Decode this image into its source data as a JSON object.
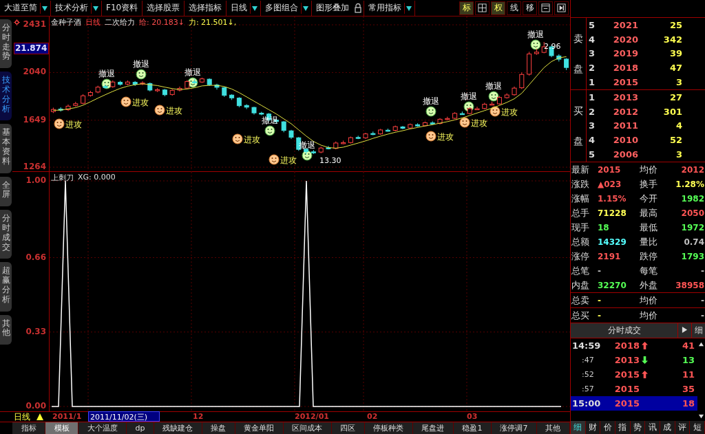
{
  "toolbar": [
    {
      "label": "大道至简",
      "dropdown": true
    },
    {
      "label": "技术分析",
      "dropdown": true
    },
    {
      "label": "F10资料",
      "dropdown": false
    },
    {
      "label": "选择股票",
      "dropdown": false
    },
    {
      "label": "选择指标",
      "dropdown": false
    },
    {
      "label": "日线",
      "dropdown": true
    },
    {
      "label": "多图组合",
      "dropdown": true
    },
    {
      "label": "图形叠加",
      "dropdown": false,
      "lock": true
    },
    {
      "label": "常用指标",
      "dropdown": true
    }
  ],
  "view_buttons": [
    {
      "kind": "text",
      "label": "标",
      "selected": true
    },
    {
      "kind": "grid",
      "selected": false
    },
    {
      "kind": "text",
      "label": "权",
      "selected": true
    },
    {
      "kind": "text",
      "label": "线",
      "selected": false
    },
    {
      "kind": "text",
      "label": "移",
      "selected": false
    },
    {
      "kind": "window",
      "selected": false
    },
    {
      "kind": "next",
      "selected": false
    }
  ],
  "side_tabs": [
    {
      "label": "分时走势",
      "selected": false
    },
    {
      "label": "技术分析",
      "selected": true
    },
    {
      "label": "基本资料",
      "selected": false
    },
    {
      "label": "全屏",
      "selected": false
    },
    {
      "label": "分时成交",
      "selected": false
    },
    {
      "label": "超赢分析",
      "selected": false
    },
    {
      "label": "其他",
      "selected": false
    }
  ],
  "price_chart": {
    "stock": "金种子酒",
    "period": "日线",
    "indicator": "二次给力",
    "cursor_label": "21.874",
    "chart_data": {
      "type": "candlestick",
      "grid": true,
      "ylim": [
        1225,
        2499
      ],
      "ohlc": [
        [
          1720,
          1752,
          1708,
          1737
        ],
        [
          1740,
          1755,
          1720,
          1732
        ],
        [
          1735,
          1778,
          1725,
          1764
        ],
        [
          1770,
          1800,
          1760,
          1784
        ],
        [
          1788,
          1862,
          1780,
          1849
        ],
        [
          1852,
          1890,
          1842,
          1876
        ],
        [
          1880,
          1932,
          1870,
          1920
        ],
        [
          1925,
          1942,
          1910,
          1921
        ],
        [
          1924,
          1975,
          1915,
          1962
        ],
        [
          1960,
          1972,
          1932,
          1943
        ],
        [
          1945,
          1975,
          1935,
          1962
        ],
        [
          1960,
          1970,
          1930,
          1944
        ],
        [
          1946,
          1968,
          1936,
          1954
        ],
        [
          1950,
          1958,
          1885,
          1896
        ],
        [
          1894,
          1912,
          1880,
          1899
        ],
        [
          1897,
          1905,
          1845,
          1858
        ],
        [
          1860,
          1905,
          1850,
          1894
        ],
        [
          1896,
          1925,
          1885,
          1910
        ],
        [
          1912,
          1978,
          1905,
          1966
        ],
        [
          1964,
          1988,
          1950,
          1960
        ],
        [
          1962,
          1998,
          1955,
          1988
        ],
        [
          1985,
          1992,
          1930,
          1940
        ],
        [
          1938,
          1948,
          1900,
          1919
        ],
        [
          1916,
          1922,
          1840,
          1853
        ],
        [
          1855,
          1862,
          1815,
          1832
        ],
        [
          1830,
          1838,
          1755,
          1768
        ],
        [
          1770,
          1780,
          1740,
          1756
        ],
        [
          1754,
          1760,
          1695,
          1709
        ],
        [
          1707,
          1718,
          1690,
          1702
        ],
        [
          1700,
          1708,
          1640,
          1652
        ],
        [
          1650,
          1662,
          1620,
          1638
        ],
        [
          1636,
          1642,
          1550,
          1565
        ],
        [
          1562,
          1570,
          1495,
          1509
        ],
        [
          1505,
          1512,
          1398,
          1410
        ],
        [
          1412,
          1420,
          1370,
          1392
        ],
        [
          1390,
          1405,
          1372,
          1386
        ],
        [
          1388,
          1432,
          1378,
          1421
        ],
        [
          1423,
          1438,
          1410,
          1420
        ],
        [
          1418,
          1475,
          1410,
          1462
        ],
        [
          1464,
          1482,
          1452,
          1465
        ],
        [
          1466,
          1515,
          1458,
          1506
        ],
        [
          1508,
          1522,
          1494,
          1502
        ],
        [
          1504,
          1546,
          1496,
          1537
        ],
        [
          1540,
          1556,
          1526,
          1535
        ],
        [
          1537,
          1578,
          1530,
          1569
        ],
        [
          1567,
          1580,
          1555,
          1564
        ],
        [
          1566,
          1605,
          1558,
          1596
        ],
        [
          1594,
          1602,
          1575,
          1583
        ],
        [
          1585,
          1622,
          1578,
          1614
        ],
        [
          1612,
          1624,
          1594,
          1602
        ],
        [
          1604,
          1638,
          1598,
          1629
        ],
        [
          1627,
          1640,
          1612,
          1620
        ],
        [
          1622,
          1666,
          1615,
          1657
        ],
        [
          1655,
          1678,
          1648,
          1663
        ],
        [
          1665,
          1715,
          1658,
          1705
        ],
        [
          1703,
          1720,
          1694,
          1702
        ],
        [
          1704,
          1755,
          1698,
          1744
        ],
        [
          1742,
          1760,
          1735,
          1743
        ],
        [
          1745,
          1792,
          1738,
          1780
        ],
        [
          1778,
          1802,
          1770,
          1781
        ],
        [
          1783,
          1848,
          1776,
          1836
        ],
        [
          1834,
          1870,
          1826,
          1856
        ],
        [
          1858,
          1925,
          1850,
          1912
        ],
        [
          1915,
          2040,
          1905,
          2024
        ],
        [
          2026,
          2210,
          2015,
          2192
        ],
        [
          2195,
          2235,
          2185,
          2207
        ],
        [
          2205,
          2290,
          2198,
          2251
        ],
        [
          2250,
          2262,
          2165,
          2178
        ],
        [
          2176,
          2190,
          2130,
          2149
        ],
        [
          2150,
          2158,
          2060,
          2081
        ]
      ],
      "yticks": [
        {
          "value": 2431,
          "label": "2431"
        },
        {
          "value": 2040,
          "label": "2040"
        },
        {
          "value": 1649,
          "label": "1649"
        },
        {
          "value": 1264,
          "label": "1264"
        }
      ],
      "series": [
        {
          "type": "line",
          "color": "#e0e040",
          "values": [
            1730,
            1732,
            1742,
            1752,
            1772,
            1800,
            1830,
            1858,
            1885,
            1910,
            1928,
            1940,
            1948,
            1940,
            1933,
            1920,
            1908,
            1900,
            1905,
            1915,
            1930,
            1935,
            1935,
            1925,
            1905,
            1875,
            1840,
            1805,
            1770,
            1735,
            1700,
            1660,
            1620,
            1570,
            1520,
            1475,
            1445,
            1425,
            1420,
            1428,
            1445,
            1462,
            1480,
            1500,
            1518,
            1535,
            1550,
            1563,
            1578,
            1590,
            1602,
            1612,
            1625,
            1637,
            1652,
            1668,
            1688,
            1708,
            1728,
            1748,
            1770,
            1795,
            1825,
            1870,
            1940,
            2010,
            2080,
            2130,
            2160,
            2170
          ]
        }
      ]
    },
    "readouts": [
      {
        "text": "给: 20.183↓",
        "color": "#ff5050"
      },
      {
        "text": "力: 21.501↓,",
        "color": "#ffff50"
      }
    ],
    "signals": [
      {
        "kind": "attack",
        "label": "进攻"
      },
      {
        "kind": "retreat",
        "label": "撤退"
      },
      {
        "kind": "attack",
        "label": "进攻"
      },
      {
        "kind": "retreat",
        "label": "撤退"
      },
      {
        "kind": "attack",
        "label": "进攻"
      },
      {
        "kind": "retreat",
        "label": "撤退"
      },
      {
        "kind": "attack",
        "label": "进攻"
      },
      {
        "kind": "retreat",
        "label": "撤退"
      },
      {
        "kind": "attack",
        "label": "进攻"
      },
      {
        "kind": "retreat",
        "label": "撤退"
      },
      {
        "kind": "retreat",
        "label": "撤退"
      },
      {
        "kind": "attack",
        "label": "进攻"
      },
      {
        "kind": "retreat",
        "label": "撤退"
      },
      {
        "kind": "attack",
        "label": "进攻"
      },
      {
        "kind": "retreat",
        "label": "撤退"
      },
      {
        "kind": "attack",
        "label": "进攻"
      },
      {
        "kind": "retreat",
        "label": "撤退"
      }
    ],
    "low_mark": "13.30",
    "high_mark": "2.96"
  },
  "indicator_chart": {
    "name": "上刺刀",
    "readout": "XG: 0.000",
    "chart_data": {
      "type": "line",
      "ylim": [
        0,
        1
      ],
      "yticks": [
        {
          "value": 1,
          "label": "1.00"
        },
        {
          "value": 0.66,
          "label": "0.66"
        },
        {
          "value": 0.33,
          "label": "0.33"
        },
        {
          "value": 0,
          "label": "0.00"
        }
      ],
      "series": [
        {
          "color": "#ffffff",
          "values": [
            0,
            0,
            1,
            0,
            0,
            0,
            0,
            0,
            0,
            0,
            0,
            0,
            0,
            0,
            0,
            0,
            0,
            0,
            0,
            0,
            0,
            0,
            0,
            0,
            0,
            0,
            0,
            0,
            0,
            0,
            0,
            0,
            0,
            0,
            0,
            0,
            0,
            1,
            0,
            0,
            0,
            0,
            0,
            0,
            0,
            0,
            0,
            0,
            0,
            0,
            0,
            0,
            0,
            0,
            0,
            0,
            0,
            0,
            0,
            0,
            0,
            0,
            0,
            0,
            0,
            0,
            0,
            0,
            0,
            0,
            0,
            0,
            0,
            0,
            0
          ]
        }
      ]
    }
  },
  "date_bar": {
    "period": "日线",
    "dates": [
      "2011/1",
      "12",
      "2012/01",
      "02",
      "03"
    ],
    "cursor_date": "2011/11/02(三)"
  },
  "bottom_tabs": [
    {
      "label": "指标",
      "selected": false
    },
    {
      "label": "模板",
      "selected": true
    },
    {
      "label": "大个温度",
      "selected": false
    },
    {
      "label": "dp",
      "selected": false
    },
    {
      "label": "残缺建仓",
      "selected": false
    },
    {
      "label": "操盘",
      "selected": false
    },
    {
      "label": "黄金单阳",
      "selected": false
    },
    {
      "label": "区间成本",
      "selected": false
    },
    {
      "label": "四区",
      "selected": false
    },
    {
      "label": "停板种类",
      "selected": false
    },
    {
      "label": "尾盘进",
      "selected": false
    },
    {
      "label": "稳盈1",
      "selected": false
    },
    {
      "label": "涨停调7",
      "selected": false
    },
    {
      "label": "其他",
      "selected": false
    }
  ],
  "order_book": {
    "sell_label": "卖盘",
    "sell": [
      {
        "level": "5",
        "price": "2021",
        "volume": "25"
      },
      {
        "level": "4",
        "price": "2020",
        "volume": "342"
      },
      {
        "level": "3",
        "price": "2019",
        "volume": "39"
      },
      {
        "level": "2",
        "price": "2018",
        "volume": "47"
      },
      {
        "level": "1",
        "price": "2015",
        "volume": "3"
      }
    ],
    "buy_label": "买盘",
    "buy": [
      {
        "level": "1",
        "price": "2013",
        "volume": "27"
      },
      {
        "level": "2",
        "price": "2012",
        "volume": "301"
      },
      {
        "level": "3",
        "price": "2011",
        "volume": "4"
      },
      {
        "level": "4",
        "price": "2010",
        "volume": "52"
      },
      {
        "level": "5",
        "price": "2006",
        "volume": "3"
      }
    ]
  },
  "quote": [
    {
      "label": "最新",
      "value": "2015",
      "color": "#ff5555"
    },
    {
      "label": "均价",
      "value": "2012",
      "color": "#ff5555"
    },
    {
      "label": "涨跌",
      "value": "▲023",
      "color": "#ff5555"
    },
    {
      "label": "换手",
      "value": "1.28%",
      "color": "#ffff55"
    },
    {
      "label": "涨幅",
      "value": "1.15%",
      "color": "#ff5555"
    },
    {
      "label": "今开",
      "value": "1982",
      "color": "#55ff55"
    },
    {
      "label": "总手",
      "value": "71228",
      "color": "#ffff55"
    },
    {
      "label": "最高",
      "value": "2050",
      "color": "#ff5555"
    },
    {
      "label": "现手",
      "value": "18",
      "color": "#55ff55"
    },
    {
      "label": "最低",
      "value": "1972",
      "color": "#55ff55"
    },
    {
      "label": "总额",
      "value": "14329",
      "color": "#55ffff"
    },
    {
      "label": "量比",
      "value": "0.74",
      "color": "#c0c0c0"
    },
    {
      "label": "涨停",
      "value": "2191",
      "color": "#ff5555"
    },
    {
      "label": "跌停",
      "value": "1793",
      "color": "#55ff55"
    },
    {
      "label": "总笔",
      "value": "-",
      "color": "#c0c0c0"
    },
    {
      "label": "每笔",
      "value": "-",
      "color": "#c0c0c0"
    },
    {
      "label": "内盘",
      "value": "32270",
      "color": "#55ff55"
    },
    {
      "label": "外盘",
      "value": "38958",
      "color": "#ff5555"
    }
  ],
  "totals": [
    [
      {
        "label": "总卖",
        "value": "-",
        "color": "#ffff55"
      },
      {
        "label": "均价",
        "value": "-",
        "color": "#c0c0c0"
      }
    ],
    [
      {
        "label": "总买",
        "value": "-",
        "color": "#ffff55"
      },
      {
        "label": "均价",
        "value": "-",
        "color": "#c0c0c0"
      }
    ]
  ],
  "ticks_panel": {
    "title": "分时成交",
    "detail_button": "细",
    "ticks": [
      {
        "kind": "minute",
        "time": "14:59",
        "price": "2018",
        "rising": true,
        "falling": false,
        "volume": "41",
        "selected": false
      },
      {
        "kind": "second",
        "time": ":47",
        "price": "2013",
        "rising": false,
        "falling": true,
        "volume": "13",
        "selected": false
      },
      {
        "kind": "second",
        "time": ":52",
        "price": "2015",
        "rising": true,
        "falling": false,
        "volume": "11",
        "selected": false
      },
      {
        "kind": "second",
        "time": ":57",
        "price": "2015",
        "rising": false,
        "falling": false,
        "volume": "35",
        "selected": false
      },
      {
        "kind": "minute",
        "time": "15:00",
        "price": "2015",
        "rising": false,
        "falling": false,
        "volume": "18",
        "selected": true
      }
    ]
  },
  "panel_tabs": [
    {
      "label": "细",
      "selected": true
    },
    {
      "label": "财",
      "selected": false
    },
    {
      "label": "价",
      "selected": false
    },
    {
      "label": "指",
      "selected": false
    },
    {
      "label": "势",
      "selected": false
    },
    {
      "label": "讯",
      "selected": false
    },
    {
      "label": "成",
      "selected": false
    },
    {
      "label": "评",
      "selected": false
    },
    {
      "label": "短",
      "selected": false
    }
  ]
}
